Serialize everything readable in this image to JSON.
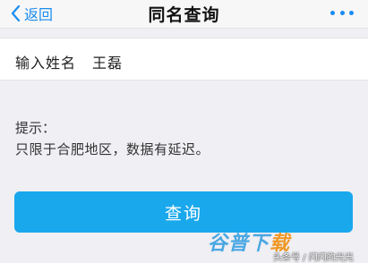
{
  "nav": {
    "back_label": "返回",
    "title": "同名查询"
  },
  "form": {
    "name_label": "输入姓名",
    "name_value": "王磊"
  },
  "hint": {
    "title": "提示：",
    "text": "只限于合肥地区，数据有延迟。"
  },
  "actions": {
    "query_label": "查询"
  },
  "watermark": {
    "logo_main": "谷普下",
    "logo_last": "载",
    "credit": "头条号 / 闪闪的光光"
  },
  "colors": {
    "accent": "#1a8cf0",
    "button": "#1aa8ec",
    "background": "#efeff4"
  },
  "icons": {
    "back": "chevron-left-icon",
    "more": "more-dots-icon"
  }
}
